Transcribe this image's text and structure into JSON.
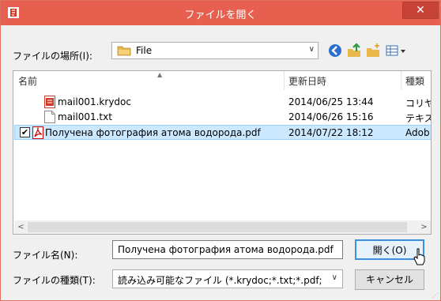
{
  "window": {
    "title": "ファイルを開く",
    "close_label": "✕",
    "accent_color": "#e7604f"
  },
  "location": {
    "label": "ファイルの場所(I):",
    "value": "File"
  },
  "toolbar": {
    "icons": [
      "back-icon",
      "up-folder-icon",
      "new-folder-icon",
      "view-menu-icon"
    ]
  },
  "columns": {
    "name": "名前",
    "modified": "更新日時",
    "type": "種類"
  },
  "files": [
    {
      "name": "mail001.krydoc",
      "modified": "2014/06/25 13:44",
      "type": "コリヤ共",
      "icon": "krydoc-icon",
      "selected": false
    },
    {
      "name": "mail001.txt",
      "modified": "2014/06/26 15:16",
      "type": "テキス",
      "icon": "text-file-icon",
      "selected": false
    },
    {
      "name": "Получена фотография атома водорода.pdf",
      "modified": "2014/07/22 18:12",
      "type": "Adob",
      "icon": "pdf-icon",
      "selected": true
    }
  ],
  "filename": {
    "label": "ファイル名(N):",
    "value": "Получена фотография атома водорода.pdf"
  },
  "filetype": {
    "label": "ファイルの種類(T):",
    "value": "読み込み可能なファイル (*.krydoc;*.txt;*.pdf;"
  },
  "buttons": {
    "open": "開く(O)",
    "cancel": "キャンセル"
  }
}
